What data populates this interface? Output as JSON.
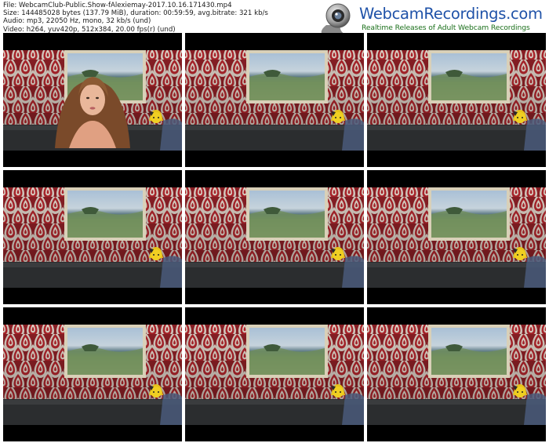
{
  "file_info": {
    "file": "File: WebcamClub-Public.Show-fAlexiemay-2017.10.16.171430.mp4",
    "size": "Size: 144485028 bytes (137.79 MiB), duration: 00:59:59, avg.bitrate: 321 kb/s",
    "audio": "Audio: mp3, 22050 Hz, mono, 32 kb/s (und)",
    "video": "Video: h264, yuv420p, 512x384, 20.00 fps(r) (und)"
  },
  "logo": {
    "title": "WebcamRecordings.com",
    "tagline": "Realtime Releases of Adult Webcam Recordings",
    "icon": "webcam-icon"
  },
  "colors": {
    "wallpaper_red": "#a8262c",
    "wallpaper_cream": "#ded3c8",
    "frame_gold": "#d9d0b8",
    "title_blue": "#1f52a8",
    "tagline_green": "#1a6f1a"
  },
  "thumbnails": [
    {
      "index": 1,
      "person": true
    },
    {
      "index": 2,
      "person": false
    },
    {
      "index": 3,
      "person": false
    },
    {
      "index": 4,
      "person": false
    },
    {
      "index": 5,
      "person": false
    },
    {
      "index": 6,
      "person": false
    },
    {
      "index": 7,
      "person": false
    },
    {
      "index": 8,
      "person": false
    },
    {
      "index": 9,
      "person": false
    }
  ]
}
